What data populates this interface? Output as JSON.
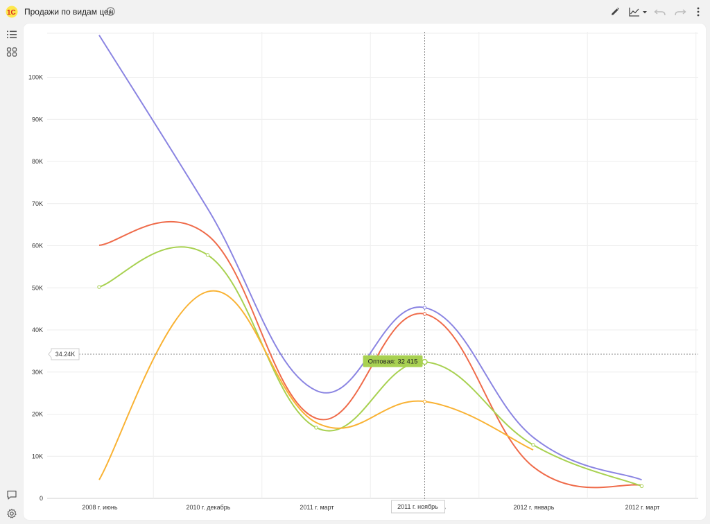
{
  "header": {
    "logo_text": "1С",
    "title": "Продажи по видам цен",
    "info_icon": "info-circle-icon",
    "tools": {
      "edit_icon": "pencil-icon",
      "chart_type_icon": "line-chart-icon",
      "undo_icon": "undo-icon",
      "redo_icon": "redo-icon",
      "more_icon": "more-vertical-icon"
    }
  },
  "sidebar": {
    "top_icons": [
      "list-icon",
      "group-icon"
    ],
    "bottom_icons": [
      "comment-icon",
      "settings-icon"
    ]
  },
  "crosshair": {
    "y_value_label": "34.24K",
    "x_category_label": "2011 г. ноябрь",
    "tooltip_text": "Оптовая: 32 415",
    "tooltip_color": "#a8d151"
  },
  "chart_data": {
    "type": "line",
    "categories": [
      "2008 г. июнь",
      "2010 г. декабрь",
      "2011 г. март",
      "2011 г. ноябрь",
      "2012 г. январь",
      "2012 г. март"
    ],
    "y_ticks": [
      {
        "value": 0,
        "label": "0"
      },
      {
        "value": 10000,
        "label": "10K"
      },
      {
        "value": 20000,
        "label": "20K"
      },
      {
        "value": 30000,
        "label": "30K"
      },
      {
        "value": 40000,
        "label": "40K"
      },
      {
        "value": 50000,
        "label": "50K"
      },
      {
        "value": 60000,
        "label": "60K"
      },
      {
        "value": 70000,
        "label": "70K"
      },
      {
        "value": 80000,
        "label": "80K"
      },
      {
        "value": 90000,
        "label": "90K"
      },
      {
        "value": 100000,
        "label": "100K"
      }
    ],
    "ylim": [
      0,
      110000
    ],
    "grid": true,
    "series": [
      {
        "color": "#8a84e2",
        "values": [
          110000,
          68800,
          25600,
          45300,
          14500,
          4400
        ]
      },
      {
        "color": "#ef6b4a",
        "values": [
          60100,
          62500,
          19000,
          43800,
          7500,
          3100
        ]
      },
      {
        "name": "Оптовая",
        "color": "#a8d151",
        "values": [
          50200,
          57800,
          16800,
          32415,
          12700,
          2900
        ]
      },
      {
        "color": "#f9b233",
        "values": [
          4400,
          49100,
          18000,
          23000,
          11500,
          null
        ]
      }
    ]
  }
}
